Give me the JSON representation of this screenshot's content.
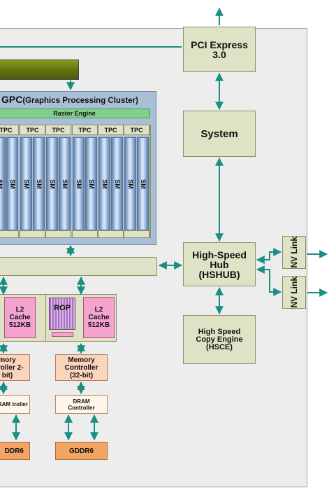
{
  "pcie": {
    "label": "PCI Express 3.0"
  },
  "system": {
    "label": "System"
  },
  "hshub": {
    "label": "High-Speed Hub (HSHUB)"
  },
  "hsce": {
    "label": "High Speed Copy Engine (HSCE)"
  },
  "nvlink": {
    "label": "NV Link"
  },
  "gpc": {
    "title": "GPC",
    "subtitle": "(Graphics Processing Cluster)",
    "raster": "Raster Engine"
  },
  "tpc_label": "TPC",
  "sm_label": "SM",
  "rop_label": "ROP",
  "l2": {
    "label": "L2 Cache 512KB"
  },
  "mem": {
    "label": "Memory Controller (32-bit)",
    "partial": "mory ntroller 2-bit)"
  },
  "dram": {
    "label": "DRAM Controller",
    "partial": "RAM troller"
  },
  "gddr": {
    "label": "GDDR6",
    "partial": "DDR6"
  },
  "colors": {
    "arrow": "#1a8f80",
    "gpc": "#a9bfd6",
    "sm": "#5a7fb0",
    "l2": "#f4a3cf"
  }
}
